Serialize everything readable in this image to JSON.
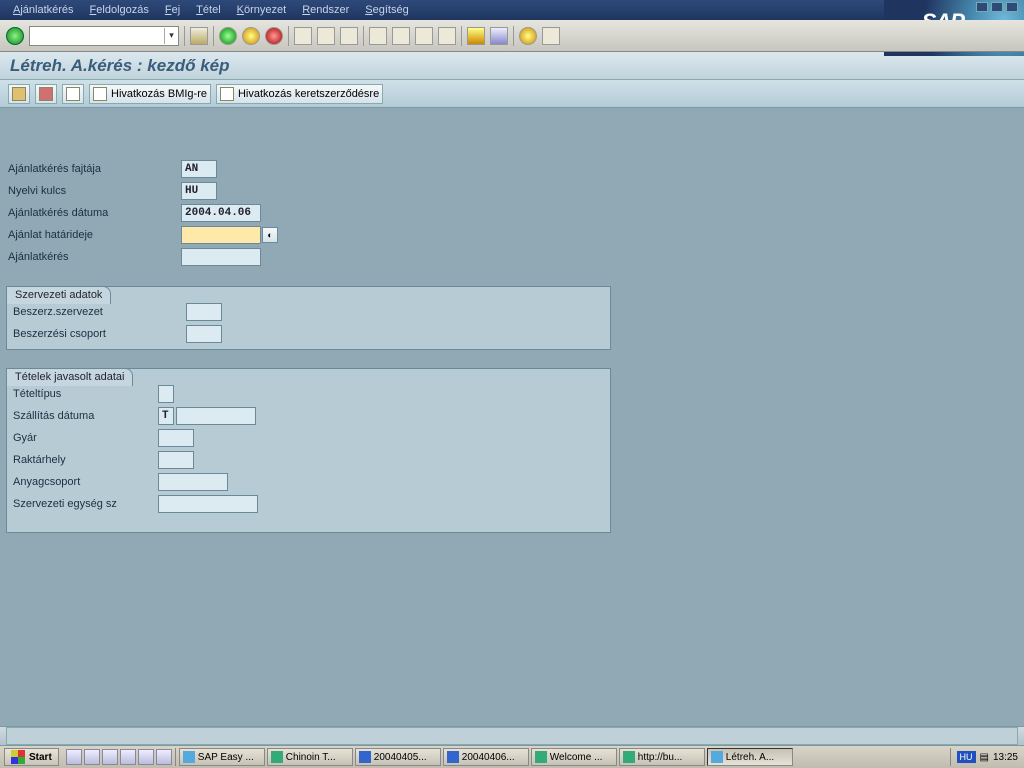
{
  "menu": [
    "Ajánlatkérés",
    "Feldolgozás",
    "Fej",
    "Tétel",
    "Környezet",
    "Rendszer",
    "Segítség"
  ],
  "logo": "SAP",
  "title": "Létreh. A.kérés : kezdő kép",
  "apptoolbar": {
    "ref_bmig": "Hivatkozás BMIg-re",
    "ref_keret": "Hivatkozás keretszerződésre"
  },
  "fields": {
    "rfq_type_lbl": "Ajánlatkérés fajtája",
    "rfq_type_val": "AN",
    "lang_lbl": "Nyelvi kulcs",
    "lang_val": "HU",
    "rfq_date_lbl": "Ajánlatkérés dátuma",
    "rfq_date_val": "2004.04.06",
    "deadline_lbl": "Ajánlat határideje",
    "deadline_val": "",
    "rfq_lbl": "Ajánlatkérés",
    "rfq_val": ""
  },
  "org": {
    "title": "Szervezeti adatok",
    "purch_org_lbl": "Beszerz.szervezet",
    "purch_org_val": "",
    "purch_grp_lbl": "Beszerzési csoport",
    "purch_grp_val": ""
  },
  "items": {
    "title": "Tételek javasolt adatai",
    "item_type_lbl": "Tételtípus",
    "item_type_val": "",
    "deliv_date_lbl": "Szállítás dátuma",
    "deliv_date_t": "T",
    "deliv_date_val": "",
    "plant_lbl": "Gyár",
    "plant_val": "",
    "storage_lbl": "Raktárhely",
    "storage_val": "",
    "matgrp_lbl": "Anyagcsoport",
    "matgrp_val": "",
    "orgunit_lbl": "Szervezeti egység sz",
    "orgunit_val": ""
  },
  "taskbar": {
    "start": "Start",
    "tasks": [
      "SAP Easy ...",
      "Chinoin T...",
      "20040405...",
      "20040406...",
      "Welcome ...",
      "http://bu...",
      "Létreh. A..."
    ],
    "lang": "HU",
    "clock": "13:25"
  }
}
